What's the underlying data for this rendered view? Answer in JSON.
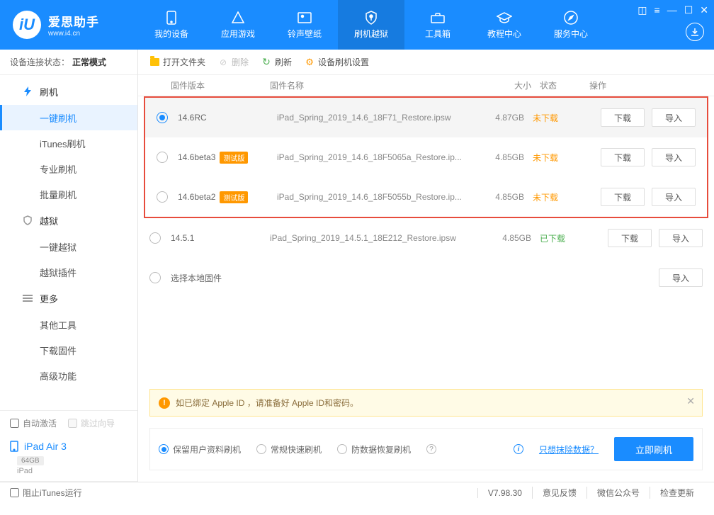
{
  "logo": {
    "title": "爱思助手",
    "sub": "www.i4.cn"
  },
  "nav": {
    "items": [
      {
        "label": "我的设备"
      },
      {
        "label": "应用游戏"
      },
      {
        "label": "铃声壁纸"
      },
      {
        "label": "刷机越狱"
      },
      {
        "label": "工具箱"
      },
      {
        "label": "教程中心"
      },
      {
        "label": "服务中心"
      }
    ]
  },
  "sidebar": {
    "conn_label": "设备连接状态：",
    "conn_value": "正常模式",
    "groups": {
      "flash": {
        "label": "刷机",
        "items": [
          "一键刷机",
          "iTunes刷机",
          "专业刷机",
          "批量刷机"
        ]
      },
      "jailbreak": {
        "label": "越狱",
        "items": [
          "一键越狱",
          "越狱插件"
        ]
      },
      "more": {
        "label": "更多",
        "items": [
          "其他工具",
          "下载固件",
          "高级功能"
        ]
      }
    },
    "auto_activate": "自动激活",
    "skip_wizard": "跳过向导",
    "device_name": "iPad Air 3",
    "device_storage": "64GB",
    "device_type": "iPad"
  },
  "toolbar": {
    "open_folder": "打开文件夹",
    "delete": "删除",
    "refresh": "刷新",
    "settings": "设备刷机设置"
  },
  "table": {
    "headers": {
      "version": "固件版本",
      "name": "固件名称",
      "size": "大小",
      "status": "状态",
      "ops": "操作"
    },
    "btn_download": "下载",
    "btn_import": "导入",
    "tag_beta": "测试版",
    "rows": [
      {
        "version": "14.6RC",
        "name": "iPad_Spring_2019_14.6_18F71_Restore.ipsw",
        "size": "4.87GB",
        "status": "未下载",
        "status_cls": "st-not",
        "beta": false
      },
      {
        "version": "14.6beta3",
        "name": "iPad_Spring_2019_14.6_18F5065a_Restore.ip...",
        "size": "4.85GB",
        "status": "未下载",
        "status_cls": "st-not",
        "beta": true
      },
      {
        "version": "14.6beta2",
        "name": "iPad_Spring_2019_14.6_18F5055b_Restore.ip...",
        "size": "4.85GB",
        "status": "未下载",
        "status_cls": "st-not",
        "beta": true
      },
      {
        "version": "14.5.1",
        "name": "iPad_Spring_2019_14.5.1_18E212_Restore.ipsw",
        "size": "4.85GB",
        "status": "已下载",
        "status_cls": "st-done",
        "beta": false
      }
    ],
    "local_fw": "选择本地固件"
  },
  "notice": "如已绑定 Apple ID ，请准备好 Apple ID和密码。",
  "modes": {
    "keep_data": "保留用户资料刷机",
    "normal": "常规快速刷机",
    "anti": "防数据恢复刷机",
    "erase_link": "只想抹除数据？",
    "flash_now": "立即刷机"
  },
  "footer": {
    "stop_itunes": "阻止iTunes运行",
    "version": "V7.98.30",
    "feedback": "意见反馈",
    "wechat": "微信公众号",
    "update": "检查更新"
  }
}
